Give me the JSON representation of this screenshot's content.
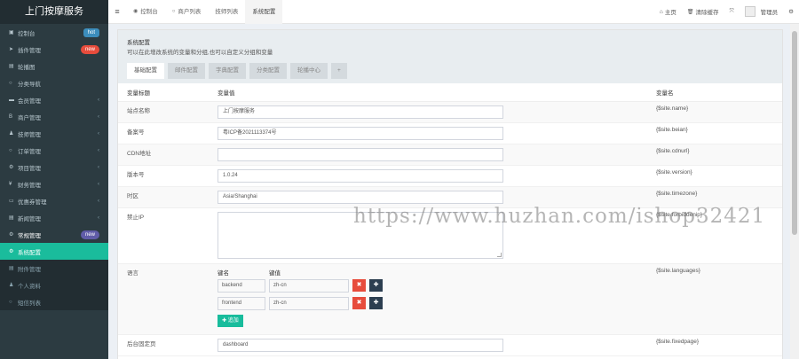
{
  "app": {
    "title": "上门按摩服务"
  },
  "sidebar": {
    "items": [
      {
        "icon": "dashboard-icon",
        "glyph": "▣",
        "label": "控制台",
        "badge": "hot",
        "badge_type": "hot",
        "chev": "",
        "state": "normal"
      },
      {
        "icon": "plugin-icon",
        "glyph": "➤",
        "label": "插件管理",
        "badge": "new",
        "badge_type": "new-red",
        "chev": "",
        "state": "normal"
      },
      {
        "icon": "carousel-icon",
        "glyph": "▤",
        "label": "轮播图",
        "badge": "",
        "badge_type": "",
        "chev": "",
        "state": "normal"
      },
      {
        "icon": "category-icon",
        "glyph": "○",
        "label": "分类导航",
        "badge": "",
        "badge_type": "",
        "chev": "",
        "state": "normal"
      },
      {
        "icon": "member-icon",
        "glyph": "▬",
        "label": "会员管理",
        "badge": "",
        "badge_type": "",
        "chev": "‹",
        "state": "normal"
      },
      {
        "icon": "merchant-icon",
        "glyph": "B",
        "label": "商户管理",
        "badge": "",
        "badge_type": "",
        "chev": "‹",
        "state": "normal"
      },
      {
        "icon": "technician-icon",
        "glyph": "♟",
        "label": "技师管理",
        "badge": "",
        "badge_type": "",
        "chev": "‹",
        "state": "normal"
      },
      {
        "icon": "order-icon",
        "glyph": "○",
        "label": "订单管理",
        "badge": "",
        "badge_type": "",
        "chev": "‹",
        "state": "normal"
      },
      {
        "icon": "project-icon",
        "glyph": "⚙",
        "label": "项目管理",
        "badge": "",
        "badge_type": "",
        "chev": "‹",
        "state": "normal"
      },
      {
        "icon": "finance-icon",
        "glyph": "¥",
        "label": "财务管理",
        "badge": "",
        "badge_type": "",
        "chev": "‹",
        "state": "normal"
      },
      {
        "icon": "coupon-icon",
        "glyph": "▭",
        "label": "优惠券管理",
        "badge": "",
        "badge_type": "",
        "chev": "‹",
        "state": "normal"
      },
      {
        "icon": "news-icon",
        "glyph": "▤",
        "label": "新闻管理",
        "badge": "",
        "badge_type": "",
        "chev": "‹",
        "state": "normal"
      },
      {
        "icon": "settings-group-icon",
        "glyph": "⚙",
        "label": "常规管理",
        "badge": "new",
        "badge_type": "new-blue",
        "chev": "",
        "state": "highlight"
      },
      {
        "icon": "config-icon",
        "glyph": "⚙",
        "label": "系统配置",
        "badge": "",
        "badge_type": "",
        "chev": "",
        "state": "active"
      },
      {
        "icon": "attachment-icon",
        "glyph": "▤",
        "label": "附件管理",
        "badge": "",
        "badge_type": "",
        "chev": "",
        "state": "dim"
      },
      {
        "icon": "profile-icon",
        "glyph": "♟",
        "label": "个人资料",
        "badge": "",
        "badge_type": "",
        "chev": "",
        "state": "dim"
      },
      {
        "icon": "sms-icon",
        "glyph": "○",
        "label": "短信列表",
        "badge": "",
        "badge_type": "",
        "chev": "",
        "state": "dim"
      }
    ]
  },
  "topbar": {
    "tabs": [
      {
        "icon": "dashboard-tab-icon",
        "glyph": "◉",
        "label": "控制台",
        "active": false
      },
      {
        "icon": "merchant-tab-icon",
        "glyph": "○",
        "label": "商户列表",
        "active": false
      },
      {
        "icon": "",
        "glyph": "",
        "label": "技师列表",
        "active": false
      },
      {
        "icon": "",
        "glyph": "",
        "label": "系统配置",
        "active": true
      }
    ],
    "home": {
      "glyph": "⌂",
      "label": "主页"
    },
    "clear_cache": {
      "glyph": "🗑",
      "label": "清除缓存"
    },
    "admin_label": "管理员"
  },
  "panel": {
    "title": "系统配置",
    "subtitle": "可以在此增改系统的变量和分组,也可以自定义分组和变量",
    "tabs": [
      "基础配置",
      "邮件配置",
      "字典配置",
      "分类配置",
      "轮播中心"
    ],
    "plus": "+"
  },
  "table": {
    "headers": {
      "title": "变量标题",
      "value": "变量值",
      "name": "变量名"
    },
    "rows": [
      {
        "title": "站点名称",
        "value": "上门按摩服务",
        "name": "{$site.name}",
        "type": "input"
      },
      {
        "title": "备案号",
        "value": "粤ICP备2021113374号",
        "name": "{$site.beian}",
        "type": "input"
      },
      {
        "title": "CDN地址",
        "value": "",
        "name": "{$site.cdnurl}",
        "type": "input"
      },
      {
        "title": "版本号",
        "value": "1.0.24",
        "name": "{$site.version}",
        "type": "input"
      },
      {
        "title": "时区",
        "value": "Asia/Shanghai",
        "name": "{$site.timezone}",
        "type": "input"
      },
      {
        "title": "禁止IP",
        "value": "",
        "name": "{$site.forbiddenip}",
        "type": "textarea"
      }
    ],
    "languages": {
      "title": "语言",
      "name": "{$site.languages}",
      "key_header": "键名",
      "value_header": "键值",
      "entries": [
        {
          "key": "backend",
          "value": "zh-cn"
        },
        {
          "key": "frontend",
          "value": "zh-cn"
        }
      ],
      "add_label": "追加"
    },
    "fixedpage": {
      "title": "后台固定页",
      "value": "dashboard",
      "name": "{$site.fixedpage}"
    }
  },
  "watermark": "https://www.huzhan.com/ishop32421"
}
